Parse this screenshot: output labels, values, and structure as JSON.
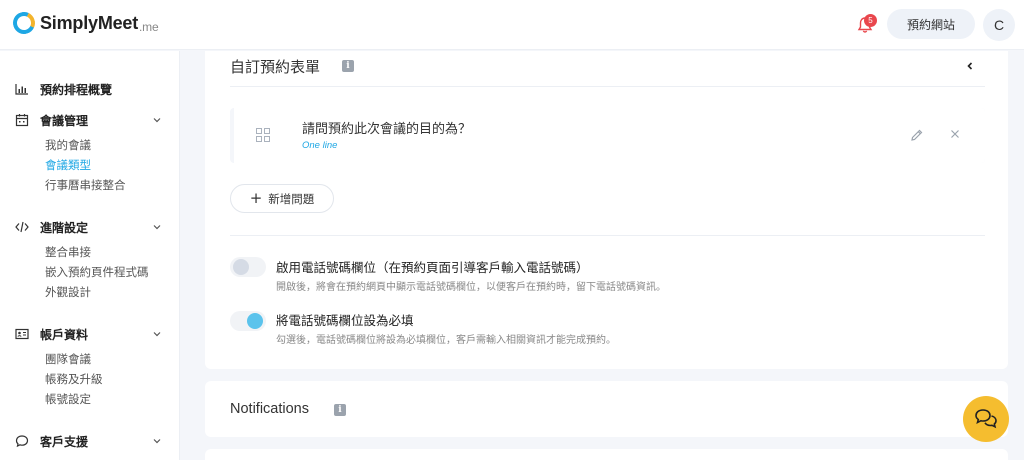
{
  "header": {
    "logo_text": "SimplyMeet",
    "logo_suffix": ".me",
    "notification_count": "5",
    "booking_site_label": "預約網站",
    "avatar_initial": "C"
  },
  "sidebar": {
    "overview": {
      "label": "預約排程概覽",
      "icon": "bar-chart-icon"
    },
    "meetings": {
      "label": "會議管理",
      "icon": "calendar-icon",
      "items": [
        "我的會議",
        "會議類型",
        "行事曆串接整合"
      ],
      "active_index": 1
    },
    "advanced": {
      "label": "進階設定",
      "icon": "code-icon",
      "items": [
        "整合串接",
        "嵌入預約頁件程式碼",
        "外觀設計"
      ]
    },
    "account": {
      "label": "帳戶資料",
      "icon": "id-card-icon",
      "items": [
        "團隊會議",
        "帳務及升級",
        "帳號設定"
      ]
    },
    "support": {
      "label": "客戶支援",
      "icon": "chat-bubble-icon"
    }
  },
  "booking_form": {
    "title": "自訂預約表單",
    "question": {
      "text": "請問預約此次會議的目的為？",
      "type": "One line"
    },
    "add_question_label": "新增問題",
    "phone_field": {
      "enabled": false,
      "title": "啟用電話號碼欄位（在預約頁面引導客戶輸入電話號碼）",
      "desc": "開啟後，將會在預約網頁中顯示電話號碼欄位，以便客戶在預約時，留下電話號碼資訊。"
    },
    "phone_required": {
      "enabled": true,
      "title": "將電話號碼欄位設為必填",
      "desc": "勾選後，電話號碼欄位將設為必填欄位，客戶需輸入相關資訊才能完成預約。"
    }
  },
  "notifications": {
    "title": "Notifications"
  },
  "colors": {
    "accent": "#1ea7e4",
    "brand_yellow": "#f5bd2f",
    "badge_red": "#e9474d"
  }
}
